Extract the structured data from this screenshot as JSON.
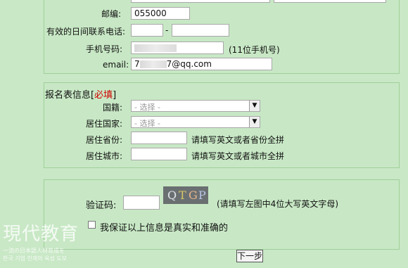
{
  "contact": {
    "postcode_label": "邮编:",
    "postcode_value": "055000",
    "daytime_phone_label": "有效的日间联系电话:",
    "phone_separator": "-",
    "mobile_label": "手机号码:",
    "mobile_hint": "(11位手机号)",
    "email_label": "email:",
    "email_prefix": "7",
    "email_suffix": "7@qq.com"
  },
  "registration": {
    "heading": "报名表信息",
    "required_marker": "必填",
    "nationality_label": "国籍:",
    "nationality_selected": "- 选择 -",
    "residence_country_label": "居住国家:",
    "residence_country_selected": "- 选择 -",
    "province_label": "居住省份:",
    "province_hint": "请填写英文或者省份全拼",
    "city_label": "居住城市:",
    "city_hint": "请填写英文或者城市全拼"
  },
  "verification": {
    "captcha_label": "验证码:",
    "captcha_text": "QTGP",
    "captcha_hint": "(请填写左图中4位大写英文字母)",
    "confirm_label": "我保证以上信息是真实和准确的",
    "next_button": "下一步"
  },
  "watermark": {
    "logo_text": "現代教育",
    "tagline_1": "一流の日本語人材育成を",
    "tagline_2": "한국 기업 인재의 육성 도모"
  }
}
